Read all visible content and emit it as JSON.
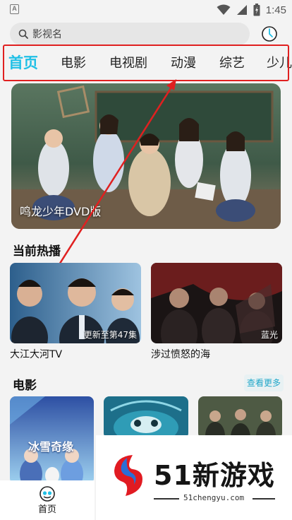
{
  "status_bar": {
    "app_badge": "A",
    "time": "1:45"
  },
  "search": {
    "placeholder": "影视名"
  },
  "tabs": [
    {
      "label": "首页",
      "active": true
    },
    {
      "label": "电影",
      "active": false
    },
    {
      "label": "电视剧",
      "active": false
    },
    {
      "label": "动漫",
      "active": false
    },
    {
      "label": "综艺",
      "active": false
    },
    {
      "label": "少儿",
      "active": false
    }
  ],
  "banner": {
    "caption": "鸣龙少年DVD版"
  },
  "now_playing": {
    "title": "当前热播",
    "items": [
      {
        "title": "大江大河TV",
        "badge": "更新至第47集"
      },
      {
        "title": "涉过愤怒的海",
        "badge": "蓝光"
      }
    ]
  },
  "movies": {
    "title": "电影",
    "see_more": "查看更多",
    "items": [
      {
        "poster_title": "冰雪奇缘"
      },
      {
        "poster_title": ""
      },
      {
        "poster_title": ""
      }
    ]
  },
  "bottom_nav": {
    "home_label": "首页"
  },
  "watermark": {
    "brand": "51新游戏",
    "domain": "51chengyu.com"
  },
  "colors": {
    "accent": "#21c0e6",
    "annotation_red": "#e02020",
    "background": "#f3f3f3"
  }
}
